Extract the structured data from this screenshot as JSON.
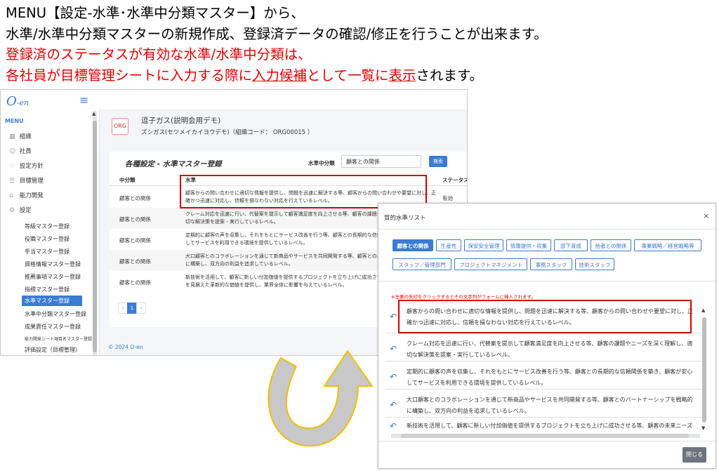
{
  "instructions": {
    "line1": "MENU【設定-水準･水準中分類マスター】から、",
    "line2": "水準/水準中分類マスターの新規作成、登録済データの確認/修正を行うことが出来ます。",
    "line3": "登録済のステータスが有効な水準/水準中分類は、",
    "line4_a": "各社員が目標管理シートに入力する際に",
    "line4_b": "入力候補",
    "line4_c": "として一覧に",
    "line4_d": "表示",
    "line4_e": "されます。"
  },
  "app": {
    "logo": "O",
    "logo_small": "-en",
    "menu_heading": "MENU",
    "nav": [
      {
        "label": "組織",
        "icon": "building-icon"
      },
      {
        "label": "社員",
        "icon": "users-icon"
      },
      {
        "label": "設定方針",
        "icon": "bulb-icon"
      },
      {
        "label": "目標管理",
        "icon": "list-icon"
      },
      {
        "label": "能力開発",
        "icon": "cap-icon"
      },
      {
        "label": "設定",
        "icon": "gear-icon"
      }
    ],
    "sub_nav": [
      "等級マスター登録",
      "役職マスター登録",
      "手当マスター登録",
      "資格情報マスター登録",
      "推薦事項マスター登録",
      "指標マスター登録",
      "水準マスター登録",
      "水準中分類マスター登録",
      "成果責任マスター登録",
      "能力開発シート項目名マスター登録",
      "評価設定（目標管理）"
    ],
    "active_sub": "水準マスター登録",
    "org_icon_text": "ORG",
    "org_name": "逗子ガス(説明会用デモ)",
    "org_sub": "ズシガス(セツメイカイヨウデモ)（組織コード： ORG00015 ）",
    "card_title": "各種設定 - 水準マスター登録",
    "search_label": "水準中分類",
    "search_value": "顧客との関係",
    "search_button": "検索",
    "col_mid": "中分類",
    "col_level": "水準",
    "col_status": "ステータス",
    "rows": [
      {
        "mid": "顧客との関係",
        "text": "顧客からの問い合わせに適切な情報を提供し、問題を迅速に解決する等、顧客からの問い合わせや要望に対し、正確かつ迅速に対応し、信頼を損なわない対応を行えているレベル。",
        "status": "有効"
      },
      {
        "mid": "顧客との関係",
        "text": "クレーム対応を迅速に行い、代替案を提示して顧客満足度を向上させる等、顧客の課題やニーズを深く理解し、適切な解決策を提案・実行しているレベル。",
        "status": ""
      },
      {
        "mid": "顧客との関係",
        "text": "定期的に顧客の声を収集し、それをもとにサービス改善を行う等、顧客との長期的な信頼関係を築き、顧客が安心してサービスを利用できる環境を提供しているレベル。",
        "status": ""
      },
      {
        "mid": "顧客との関係",
        "text": "大口顧客とのコラボレーションを通じて新商品やサービスを共同開発する等、顧客とのパートナーシップを戦略的に構築し、双方向の利益を追求しているレベル。",
        "status": ""
      },
      {
        "mid": "顧客との関係",
        "text": "新技術を活用して、顧客に新しい付加価値を提供するプロジェクトを立ち上げに成功させる等、顧客の未来ニーズを見据えた革新的な価値を提供し、業界全体に影響を与えているレベル。",
        "status": ""
      }
    ],
    "pager": [
      "‹",
      "1",
      "›"
    ],
    "footer": "© 2024 O-en"
  },
  "modal": {
    "title": "質的水準リスト",
    "close": "×",
    "tags_row1": [
      "顧客との関係",
      "生産性",
      "保安安全管理",
      "情報提供・収集",
      "部下育成",
      "他者との関係",
      "事業戦略／経営戦略等"
    ],
    "tags_row2": [
      "スタッフ／管理部門",
      "プロジェクトマネジメント",
      "事務スタッフ",
      "技術スタッフ"
    ],
    "note": "※左側の矢印をクリックするとその文字列がフォームに挿入されます。",
    "items": [
      "顧客からの問い合わせに適切な情報を提供し、問題を迅速に解決する等、顧客からの問い合わせや要望に対し、正確かつ迅速に対応し、信頼を損なわない対応を行えているレベル。",
      "クレーム対応を迅速に行い、代替案を提示して顧客満足度を向上させる等、顧客の課題やニーズを深く理解し、適切な解決策を提案・実行しているレベル。",
      "定期的に顧客の声を収集し、それをもとにサービス改善を行う等、顧客との長期的な信頼関係を築き、顧客が安心してサービスを利用できる環境を提供しているレベル。",
      "大口顧客とのコラボレーションを通じて新商品やサービスを共同開発する等、顧客とのパートナーシップを戦略的に構築し、双方向の利益を追求しているレベル。",
      "新技術を活用して、顧客に新しい付加価値を提供するプロジェクトを立ち上げに成功させる等、顧客の未来ニーズを見据えた革新的な価値を提供し、業界全体に影響を与えているレベル。"
    ],
    "close_button": "閉じる"
  },
  "colors": {
    "accent": "#3a7bd5",
    "highlight": "#d40000",
    "emphasis_text": "#e60000",
    "arrow_fill": "#c8c8c8",
    "arrow_stroke": "#f0c000"
  }
}
